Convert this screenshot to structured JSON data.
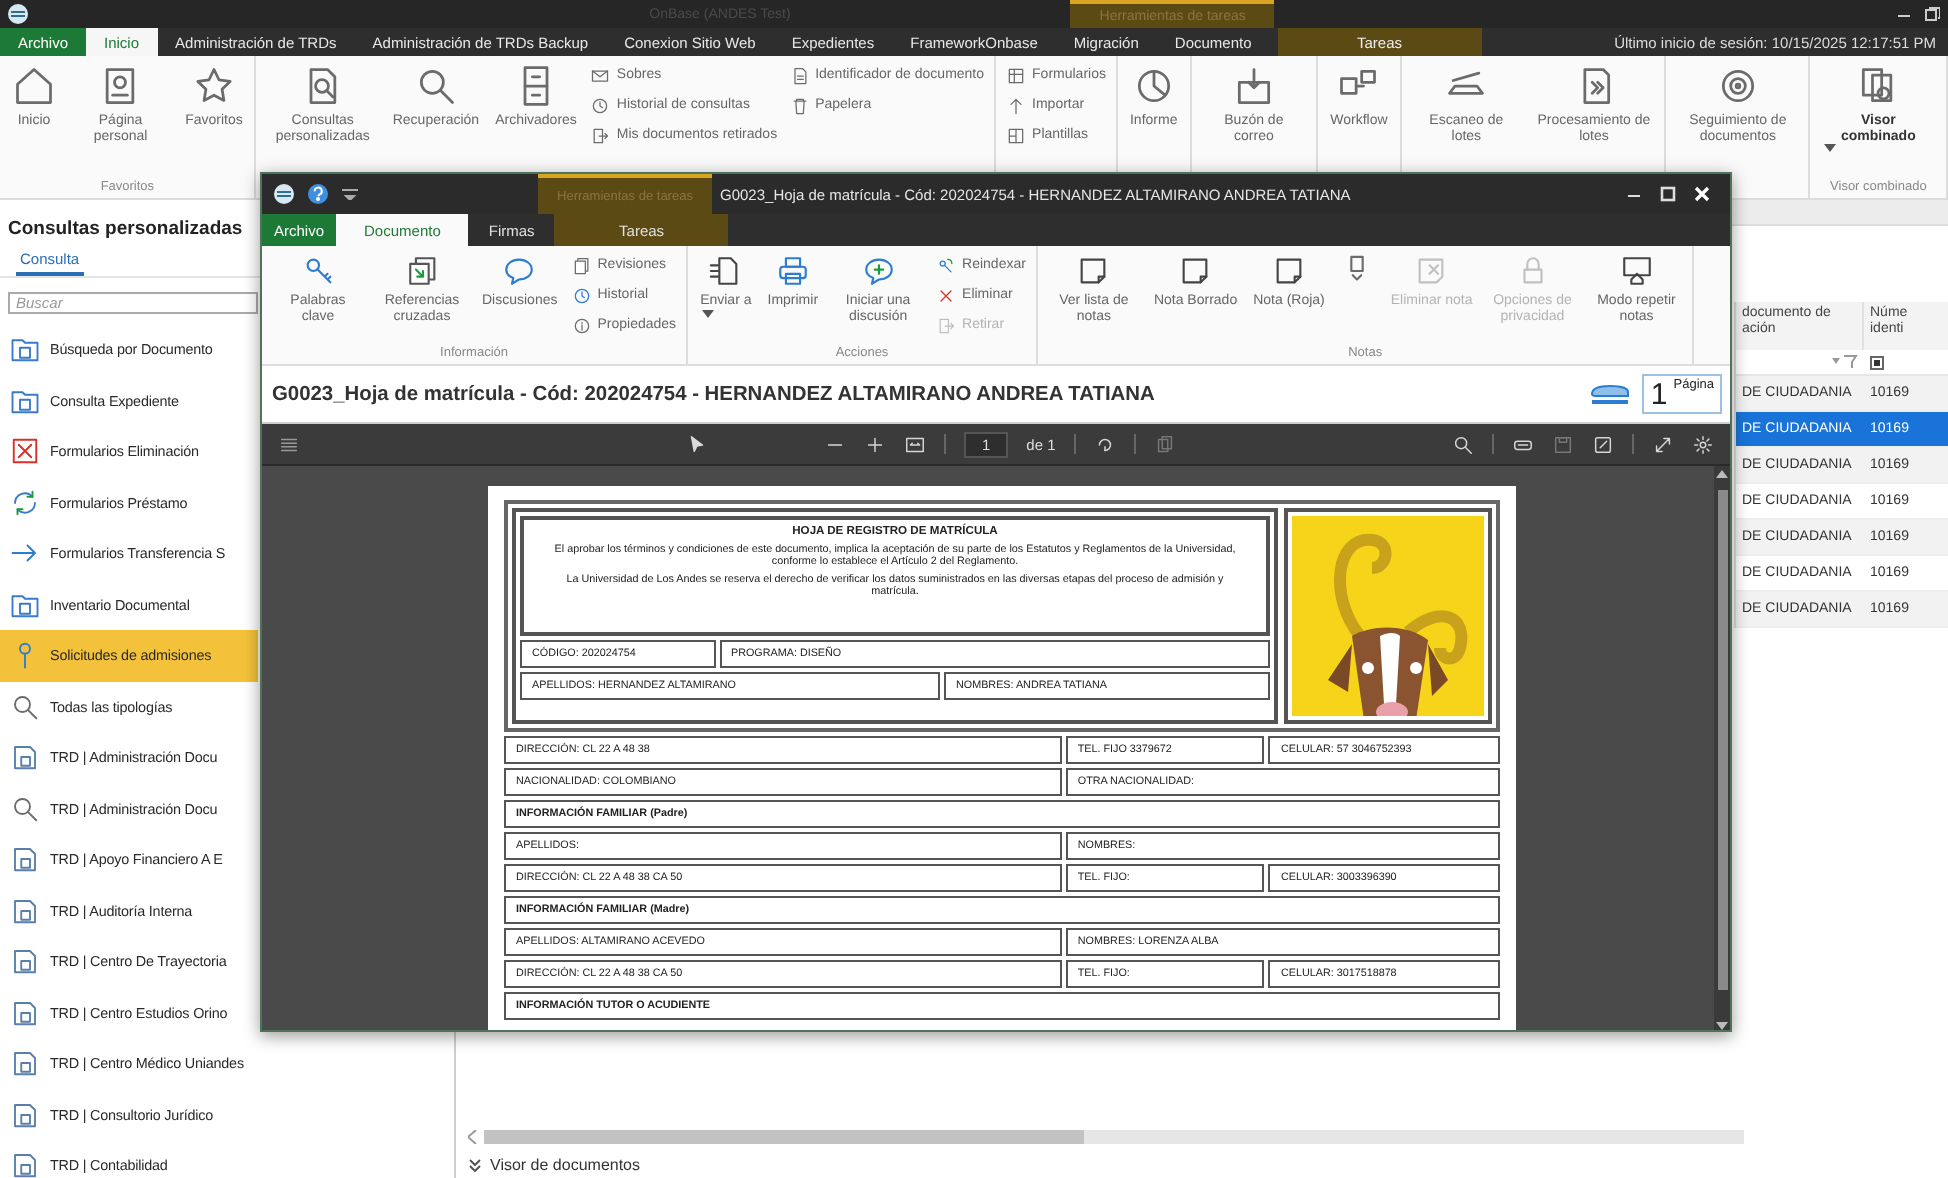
{
  "app": {
    "title": "OnBase (ANDES Test)",
    "context_group": "Herramientas de tareas"
  },
  "ribbon_tabs": [
    {
      "label": "Archivo",
      "kind": "file",
      "selected": false
    },
    {
      "label": "Inicio",
      "kind": "tab",
      "selected": true
    },
    {
      "label": "Administración de TRDs",
      "kind": "tab",
      "selected": false
    },
    {
      "label": "Administración de TRDs Backup",
      "kind": "tab",
      "selected": false
    },
    {
      "label": "Conexion Sitio Web",
      "kind": "tab",
      "selected": false
    },
    {
      "label": "Expedientes",
      "kind": "tab",
      "selected": false
    },
    {
      "label": "FrameworkOnbase",
      "kind": "tab",
      "selected": false
    },
    {
      "label": "Migración",
      "kind": "tab",
      "selected": false
    },
    {
      "label": "Documento",
      "kind": "tab",
      "selected": false
    },
    {
      "label": "Tareas",
      "kind": "context",
      "selected": false
    }
  ],
  "last_login": "Último inicio de sesión: 10/15/2025 12:17:51 PM",
  "ribbon_groups": [
    {
      "label": "Favoritos",
      "items": [
        {
          "label": "Inicio",
          "kind": "home"
        },
        {
          "label": "Página personal",
          "kind": "profile"
        },
        {
          "label": "Favoritos",
          "kind": "star"
        }
      ]
    },
    {
      "items": [
        {
          "label": "Consultas personalizadas",
          "kind": "query"
        },
        {
          "label": "Recuperación",
          "kind": "search"
        },
        {
          "label": "Archivadores",
          "kind": "cabinet"
        },
        {
          "kind": "stack",
          "items": [
            {
              "label": "Sobres",
              "kind": "envelope"
            },
            {
              "label": "Historial de consultas",
              "kind": "clock"
            },
            {
              "label": "Mis documentos retirados",
              "kind": "checkout"
            }
          ]
        },
        {
          "kind": "stack",
          "items": [
            {
              "label": "Identificador de documento",
              "kind": "docid"
            },
            {
              "label": "Papelera",
              "kind": "trash"
            }
          ]
        }
      ]
    },
    {
      "items": [
        {
          "kind": "stack",
          "items": [
            {
              "label": "Formularios",
              "kind": "form"
            },
            {
              "label": "Importar",
              "kind": "import"
            },
            {
              "label": "Plantillas",
              "kind": "template"
            }
          ]
        }
      ]
    },
    {
      "items": [
        {
          "label": "Informe",
          "kind": "report"
        }
      ]
    },
    {
      "items": [
        {
          "label": "Buzón de correo",
          "kind": "inbox"
        }
      ]
    },
    {
      "items": [
        {
          "label": "Workflow",
          "kind": "workflow"
        }
      ]
    },
    {
      "items": [
        {
          "label": "Escaneo de lotes",
          "kind": "scan"
        },
        {
          "label": "Procesamiento de lotes",
          "kind": "batch"
        }
      ]
    },
    {
      "items": [
        {
          "label": "Seguimiento de documentos",
          "kind": "tracking"
        }
      ]
    },
    {
      "label": "Visor combinado",
      "items": [
        {
          "label": "Visor combinado",
          "kind": "viewer",
          "menu": true
        }
      ]
    }
  ],
  "sidebar": {
    "title": "Consultas personalizadas",
    "tabs": [
      {
        "label": "Consulta",
        "selected": true
      }
    ],
    "search": {
      "placeholder": "Buscar"
    },
    "items": [
      {
        "label": "Búsqueda por Documento",
        "kind": "folder",
        "selected": false
      },
      {
        "label": "Consulta Expediente",
        "kind": "folder",
        "selected": false
      },
      {
        "label": "Formularios Eliminación",
        "kind": "deletion",
        "selected": false
      },
      {
        "label": "Formularios Préstamo",
        "kind": "loan",
        "selected": false
      },
      {
        "label": "Formularios Transferencia S",
        "kind": "transfer",
        "selected": false
      },
      {
        "label": "Inventario Documental",
        "kind": "folder",
        "selected": false
      },
      {
        "label": "Solicitudes de admisiones",
        "kind": "pin",
        "selected": true
      },
      {
        "label": "Todas las tipologías",
        "kind": "search",
        "selected": false
      },
      {
        "label": "TRD | Administración Docu",
        "kind": "document",
        "selected": false
      },
      {
        "label": "TRD | Administración Docu",
        "kind": "search",
        "selected": false
      },
      {
        "label": "TRD | Apoyo Financiero A E",
        "kind": "document",
        "selected": false
      },
      {
        "label": "TRD | Auditoría Interna",
        "kind": "document",
        "selected": false
      },
      {
        "label": "TRD | Centro De Trayectoria",
        "kind": "document",
        "selected": false
      },
      {
        "label": "TRD | Centro Estudios Orino",
        "kind": "document",
        "selected": false
      },
      {
        "label": "TRD | Centro Médico Uniandes",
        "kind": "document",
        "selected": false
      },
      {
        "label": "TRD | Consultorio Jurídico",
        "kind": "document",
        "selected": false
      },
      {
        "label": "TRD | Contabilidad",
        "kind": "document",
        "selected": false
      }
    ]
  },
  "results": {
    "columns": [
      {
        "lines": [
          "documento de",
          "ación"
        ]
      },
      {
        "lines": [
          "Núme",
          "identi"
        ]
      }
    ],
    "rows": [
      {
        "cells": [
          "DE CIUDADANIA",
          "10169"
        ],
        "selected": false
      },
      {
        "cells": [
          "DE CIUDADANIA",
          "10169"
        ],
        "selected": true
      },
      {
        "cells": [
          "DE CIUDADANIA",
          "10169"
        ],
        "selected": false
      },
      {
        "cells": [
          "DE CIUDADANIA",
          "10169"
        ],
        "selected": false
      },
      {
        "cells": [
          "DE CIUDADANIA",
          "10169"
        ],
        "selected": false
      },
      {
        "cells": [
          "DE CIUDADANIA",
          "10169"
        ],
        "selected": false
      },
      {
        "cells": [
          "DE CIUDADANIA",
          "10169"
        ],
        "selected": false
      }
    ]
  },
  "footer": {
    "label": "Visor de documentos"
  },
  "doc_window": {
    "context_group": "Herramientas de tareas",
    "title": "G0023_Hoja de matrícula - Cód: 202024754 - HERNANDEZ ALTAMIRANO ANDREA TATIANA",
    "tabs": [
      {
        "label": "Archivo",
        "kind": "file",
        "selected": false
      },
      {
        "label": "Documento",
        "kind": "tab",
        "selected": true
      },
      {
        "label": "Firmas",
        "kind": "tab",
        "selected": false
      },
      {
        "label": "Tareas",
        "kind": "context",
        "selected": false
      }
    ],
    "ribbon_groups": [
      {
        "label": "Información",
        "items": [
          {
            "label": "Palabras clave",
            "kind": "key",
            "disabled": false
          },
          {
            "label": "Referencias cruzadas",
            "kind": "crossref",
            "disabled": false
          },
          {
            "label": "Discusiones",
            "kind": "discussion",
            "disabled": false
          },
          {
            "kind": "stack",
            "items": [
              {
                "label": "Revisiones",
                "kind": "revisions",
                "disabled": false
              },
              {
                "label": "Historial",
                "kind": "history",
                "disabled": false
              },
              {
                "label": "Propiedades",
                "kind": "info",
                "disabled": false
              }
            ]
          }
        ]
      },
      {
        "label": "Acciones",
        "items": [
          {
            "label": "Enviar a",
            "kind": "send",
            "menu": true,
            "disabled": false
          },
          {
            "label": "Imprimir",
            "kind": "print",
            "disabled": false
          },
          {
            "label": "Iniciar una discusión",
            "kind": "discussion_new",
            "disabled": false
          },
          {
            "kind": "stack",
            "items": [
              {
                "label": "Reindexar",
                "kind": "reindex",
                "disabled": false
              },
              {
                "label": "Eliminar",
                "kind": "delete",
                "disabled": false
              },
              {
                "label": "Retirar",
                "kind": "checkout",
                "disabled": true
              }
            ]
          }
        ]
      },
      {
        "label": "Notas",
        "items": [
          {
            "label": "Ver lista de notas",
            "kind": "note",
            "disabled": false
          },
          {
            "label": "Nota Borrado",
            "kind": "note",
            "disabled": false
          },
          {
            "label": "Nota (Roja)",
            "kind": "note",
            "disabled": false
          },
          {
            "kind": "gallery",
            "disabled": false
          },
          {
            "label": "Eliminar nota",
            "kind": "note_delete",
            "disabled": true
          },
          {
            "label": "Opciones de privacidad",
            "kind": "privacy",
            "disabled": true
          },
          {
            "label": "Modo repetir notas",
            "kind": "note_repeat",
            "disabled": false
          }
        ]
      }
    ],
    "document_title": "G0023_Hoja de matrícula - Cód: 202024754 - HERNANDEZ ALTAMIRANO ANDREA TATIANA",
    "page_box": {
      "value": "1",
      "label": "Página"
    },
    "viewer": {
      "page": "1",
      "page_count": "de 1"
    },
    "document": {
      "heading": "HOJA DE REGISTRO DE MATRÍCULA",
      "notice": [
        "El aprobar los términos y condiciones de este documento, implica la aceptación de su parte de los Estatutos y Reglamentos de la Universidad, conforme lo establece el Artículo 2 del Reglamento.",
        "La Universidad de Los Andes se reserva el derecho de verificar los datos suministrados en las diversas etapas del proceso de admisión y matrícula."
      ],
      "id_rows": [
        [
          "CÓDIGO: 202024754",
          "PROGRAMA: DISEÑO"
        ],
        [
          "APELLIDOS: HERNANDEZ ALTAMIRANO",
          "NOMBRES: ANDREA TATIANA"
        ]
      ],
      "rows": [
        {
          "kind": "fields",
          "cells": [
            "DIRECCIÓN: CL 22 A 48 38",
            "TEL. FIJO 3379672",
            "CELULAR: 57 3046752393"
          ]
        },
        {
          "kind": "fields",
          "cells": [
            "NACIONALIDAD: COLOMBIANO",
            "OTRA NACIONALIDAD:"
          ]
        },
        {
          "kind": "section",
          "cells": [
            "INFORMACIÓN FAMILIAR (Padre)"
          ]
        },
        {
          "kind": "fields",
          "cells": [
            "APELLIDOS:",
            "NOMBRES:"
          ]
        },
        {
          "kind": "fields",
          "cells": [
            "DIRECCIÓN: CL 22 A 48 38 CA 50",
            "TEL. FIJO:",
            "CELULAR: 3003396390"
          ]
        },
        {
          "kind": "section",
          "cells": [
            "INFORMACIÓN FAMILIAR (Madre)"
          ]
        },
        {
          "kind": "fields",
          "cells": [
            "APELLIDOS: ALTAMIRANO ACEVEDO",
            "NOMBRES: LORENZA ALBA"
          ]
        },
        {
          "kind": "fields",
          "cells": [
            "DIRECCIÓN: CL 22 A 48 38 CA 50",
            "TEL. FIJO:",
            "CELULAR: 3017518878"
          ]
        },
        {
          "kind": "section",
          "cells": [
            "INFORMACIÓN TUTOR O ACUDIENTE"
          ]
        }
      ]
    }
  }
}
